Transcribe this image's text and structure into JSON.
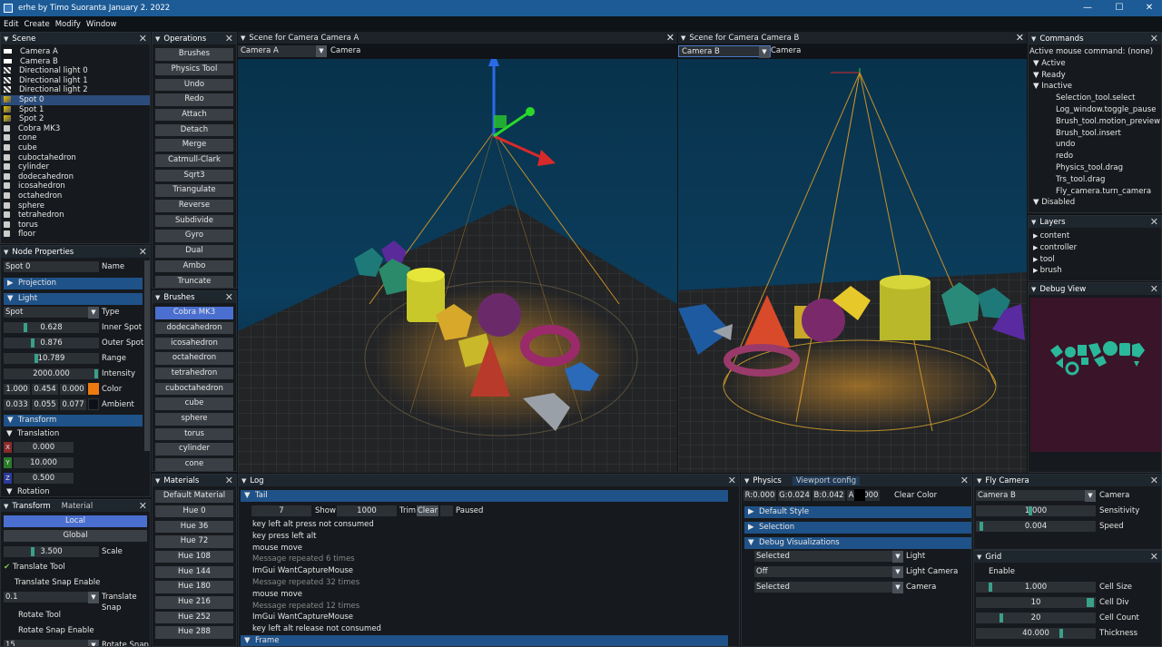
{
  "window": {
    "title": "erhe by Timo Suoranta January 2. 2022"
  },
  "menu": [
    "Edit",
    "Create",
    "Modify",
    "Window"
  ],
  "scene": {
    "title": "Scene",
    "items": [
      {
        "label": "Camera A",
        "icon": "camera"
      },
      {
        "label": "Camera B",
        "icon": "camera"
      },
      {
        "label": "Directional light 0",
        "icon": "light"
      },
      {
        "label": "Directional light 1",
        "icon": "light"
      },
      {
        "label": "Directional light 2",
        "icon": "light"
      },
      {
        "label": "Spot 0",
        "icon": "spot"
      },
      {
        "label": "Spot 1",
        "icon": "spot"
      },
      {
        "label": "Spot 2",
        "icon": "spot"
      },
      {
        "label": "Cobra MK3",
        "icon": "mesh"
      },
      {
        "label": "cone",
        "icon": "mesh"
      },
      {
        "label": "cube",
        "icon": "mesh"
      },
      {
        "label": "cuboctahedron",
        "icon": "mesh"
      },
      {
        "label": "cylinder",
        "icon": "mesh"
      },
      {
        "label": "dodecahedron",
        "icon": "mesh"
      },
      {
        "label": "icosahedron",
        "icon": "mesh"
      },
      {
        "label": "octahedron",
        "icon": "mesh"
      },
      {
        "label": "sphere",
        "icon": "mesh"
      },
      {
        "label": "tetrahedron",
        "icon": "mesh"
      },
      {
        "label": "torus",
        "icon": "mesh"
      },
      {
        "label": "floor",
        "icon": "mesh"
      }
    ]
  },
  "node_properties": {
    "title": "Node Properties",
    "name_value": "Spot 0",
    "name_label": "Name",
    "projection": "Projection",
    "light": "Light",
    "type_value": "Spot",
    "type_label": "Type",
    "inner_spot": "0.628",
    "inner_spot_label": "Inner Spot",
    "outer_spot": "0.876",
    "outer_spot_label": "Outer Spot",
    "range": "10.789",
    "range_label": "Range",
    "intensity": "2000.000",
    "intensity_label": "Intensity",
    "color_r": "1.000",
    "color_g": "0.454",
    "color_b": "0.000",
    "color_label": "Color",
    "amb_r": "0.033",
    "amb_g": "0.055",
    "amb_b": "0.077",
    "ambient_label": "Ambient",
    "transform": "Transform",
    "translation": "Translation",
    "tx": "0.000",
    "ty": "10.000",
    "tz": "0.500",
    "rotation": "Rotation",
    "color_swatch": "#ee7a10",
    "ambient_swatch": "#0e1218"
  },
  "transform_panel": {
    "tab1": "Transform",
    "tab2": "Material",
    "local": "Local",
    "global": "Global",
    "scale_value": "3.500",
    "scale_label": "Scale",
    "translate_tool": "Translate Tool",
    "translate_snap_enable": "Translate Snap Enable",
    "translate_snap_value": "0.1",
    "translate_snap_label": "Translate Snap",
    "rotate_tool": "Rotate Tool",
    "rotate_snap_enable": "Rotate Snap Enable",
    "rotate_snap_value": "15",
    "rotate_snap_label": "Rotate Snap"
  },
  "operations": {
    "title": "Operations",
    "items": [
      "Brushes",
      "Physics Tool",
      "Undo",
      "Redo",
      "Attach",
      "Detach",
      "Merge",
      "Catmull-Clark",
      "Sqrt3",
      "Triangulate",
      "Reverse",
      "Subdivide",
      "Gyro",
      "Dual",
      "Ambo",
      "Truncate"
    ]
  },
  "brushes": {
    "title": "Brushes",
    "items": [
      "Cobra MK3",
      "dodecahedron",
      "icosahedron",
      "octahedron",
      "tetrahedron",
      "cuboctahedron",
      "cube",
      "sphere",
      "torus",
      "cylinder",
      "cone"
    ]
  },
  "materials": {
    "title": "Materials",
    "items": [
      "Default Material",
      "Hue 0",
      "Hue 36",
      "Hue 72",
      "Hue 108",
      "Hue 144",
      "Hue 180",
      "Hue 216",
      "Hue 252",
      "Hue 288"
    ]
  },
  "viewport_a": {
    "title": "Scene for Camera Camera A",
    "camera_value": "Camera A",
    "camera_label": "Camera"
  },
  "viewport_b": {
    "title": "Scene for Camera Camera B",
    "camera_value": "Camera B",
    "camera_label": "Camera"
  },
  "commands": {
    "title": "Commands",
    "active_mouse": "Active mouse command: (none)",
    "active": "Active",
    "ready": "Ready",
    "inactive": "Inactive",
    "items": [
      "Selection_tool.select",
      "Log_window.toggle_pause",
      "Brush_tool.motion_preview",
      "Brush_tool.insert",
      "undo",
      "redo",
      "Physics_tool.drag",
      "Trs_tool.drag",
      "Fly_camera.turn_camera"
    ],
    "disabled": "Disabled"
  },
  "layers": {
    "title": "Layers",
    "items": [
      "content",
      "controller",
      "tool",
      "brush"
    ]
  },
  "debug_view": {
    "title": "Debug View"
  },
  "log": {
    "title": "Log",
    "tail": "Tail",
    "tail_count": "7",
    "show_label": "Show",
    "show_count": "1000",
    "trim": "Trim",
    "clear": "Clear",
    "paused": "Paused",
    "lines": [
      {
        "text": "key left alt press not consumed",
        "dim": false
      },
      {
        "text": "key press left alt",
        "dim": false
      },
      {
        "text": "mouse move",
        "dim": false
      },
      {
        "text": "Message repeated 6 times",
        "dim": true
      },
      {
        "text": "ImGui WantCaptureMouse",
        "dim": false
      },
      {
        "text": "Message repeated 32 times",
        "dim": true
      },
      {
        "text": "mouse move",
        "dim": false
      },
      {
        "text": "Message repeated 12 times",
        "dim": true
      },
      {
        "text": "ImGui WantCaptureMouse",
        "dim": false
      },
      {
        "text": "key left alt release not consumed",
        "dim": false
      }
    ],
    "frame": "Frame"
  },
  "physics": {
    "tab1": "Physics",
    "tab2": "Viewport config",
    "r": "R:0.000",
    "g": "G:0.024",
    "b": "B:0.042",
    "a": "A:1.000",
    "clear_color": "Clear Color",
    "default_style": "Default Style",
    "selection": "Selection",
    "debug_vis": "Debug Visualizations",
    "light_value": "Selected",
    "light_label": "Light",
    "light_camera_value": "Off",
    "light_camera_label": "Light Camera",
    "camera_value": "Selected",
    "camera_label": "Camera"
  },
  "fly_camera": {
    "title": "Fly Camera",
    "camera_value": "Camera B",
    "camera_label": "Camera",
    "sensitivity": "1.000",
    "sensitivity_label": "Sensitivity",
    "speed": "0.004",
    "speed_label": "Speed"
  },
  "grid": {
    "title": "Grid",
    "enable": "Enable",
    "cell_size": "1.000",
    "cell_size_label": "Cell Size",
    "cell_div": "10",
    "cell_div_label": "Cell Div",
    "cell_count": "20",
    "cell_count_label": "Cell Count",
    "thickness": "40.000",
    "thickness_label": "Thickness"
  }
}
